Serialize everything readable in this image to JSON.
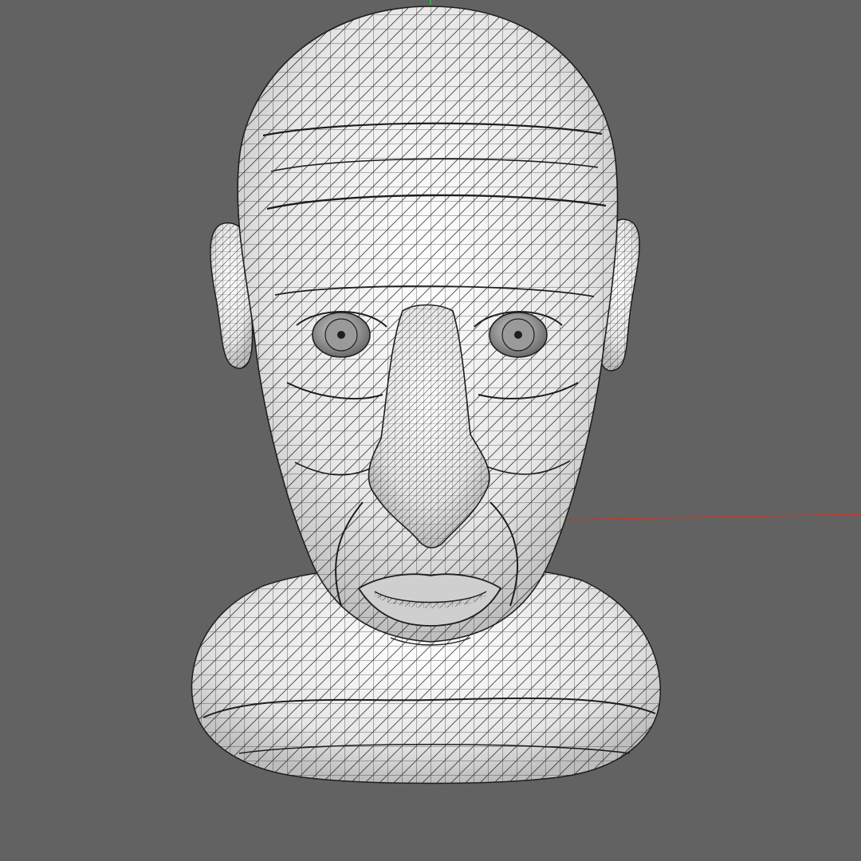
{
  "viewport": {
    "background_color": "#626262",
    "mesh_fill_color": "#f1f1f1",
    "wire_color": "#1e1e1e",
    "x_axis_color": "#c0392b",
    "y_axis_color": "#3fa34d",
    "shading": "wireframe-on-shaded"
  },
  "model": {
    "icon": "sculpted-head-bust-mesh"
  }
}
